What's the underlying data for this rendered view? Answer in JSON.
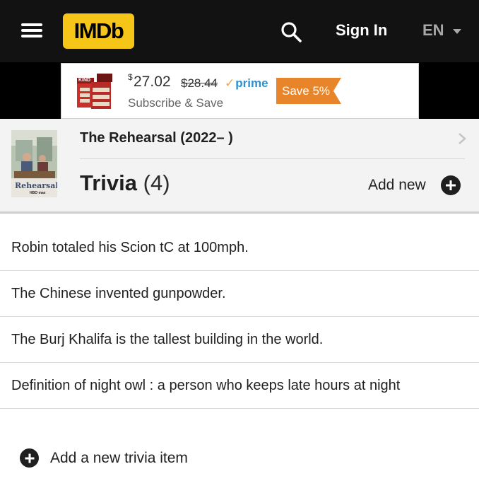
{
  "header": {
    "logo_text": "IMDb",
    "signin_label": "Sign In",
    "language": "EN",
    "logo_color": "#f5c518",
    "bar_color": "#121212"
  },
  "ad": {
    "product_label": "KIND",
    "price_currency": "$",
    "price": "27.02",
    "was_price": "$28.44",
    "prime_label": "prime",
    "subscribe_text": "Subscribe & Save",
    "save_badge": "Save 5%",
    "badge_color": "#e8842a"
  },
  "title_section": {
    "show_title": "The Rehearsal (2022– )",
    "page_title": "Trivia",
    "count": "(4)",
    "add_new_label": "Add new",
    "poster_label": "Rehearsal",
    "poster_brand": "HBO max"
  },
  "trivia": {
    "items": [
      "Robin totaled his Scion tC at 100mph.",
      "The Chinese invented gunpowder.",
      "The Burj Khalifa is the tallest building in the world.",
      "Definition of night owl : a person who keeps late hours at night"
    ],
    "add_item_label": "Add a new trivia item"
  }
}
